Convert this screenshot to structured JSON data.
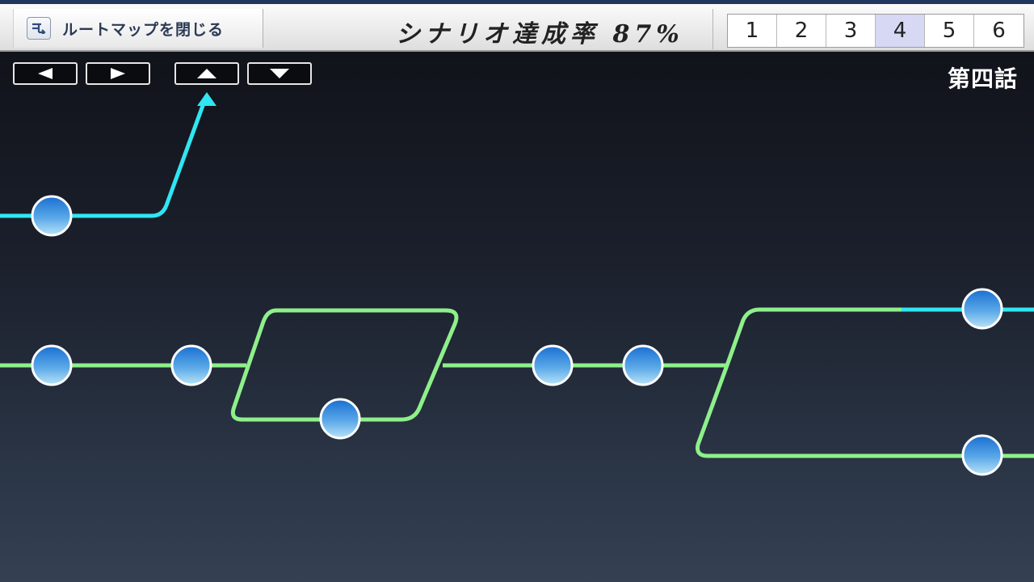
{
  "topbar": {
    "close_label": "ルートマップを閉じる",
    "completion_text": "シナリオ達成率 87%",
    "pages": [
      "1",
      "2",
      "3",
      "4",
      "5",
      "6"
    ],
    "active_page": "4"
  },
  "nav": {
    "left_icon": "left-arrow-icon",
    "right_icon": "right-arrow-icon",
    "up_icon": "up-arrow-icon",
    "down_icon": "down-arrow-icon"
  },
  "episode_label": "第四話",
  "colors": {
    "green_route": "#8ef08a",
    "cyan_route": "#2fe6f2",
    "node_fill_top": "#1a6fd1",
    "node_fill_bottom": "#a9dcf6",
    "node_border": "#ffffff"
  }
}
